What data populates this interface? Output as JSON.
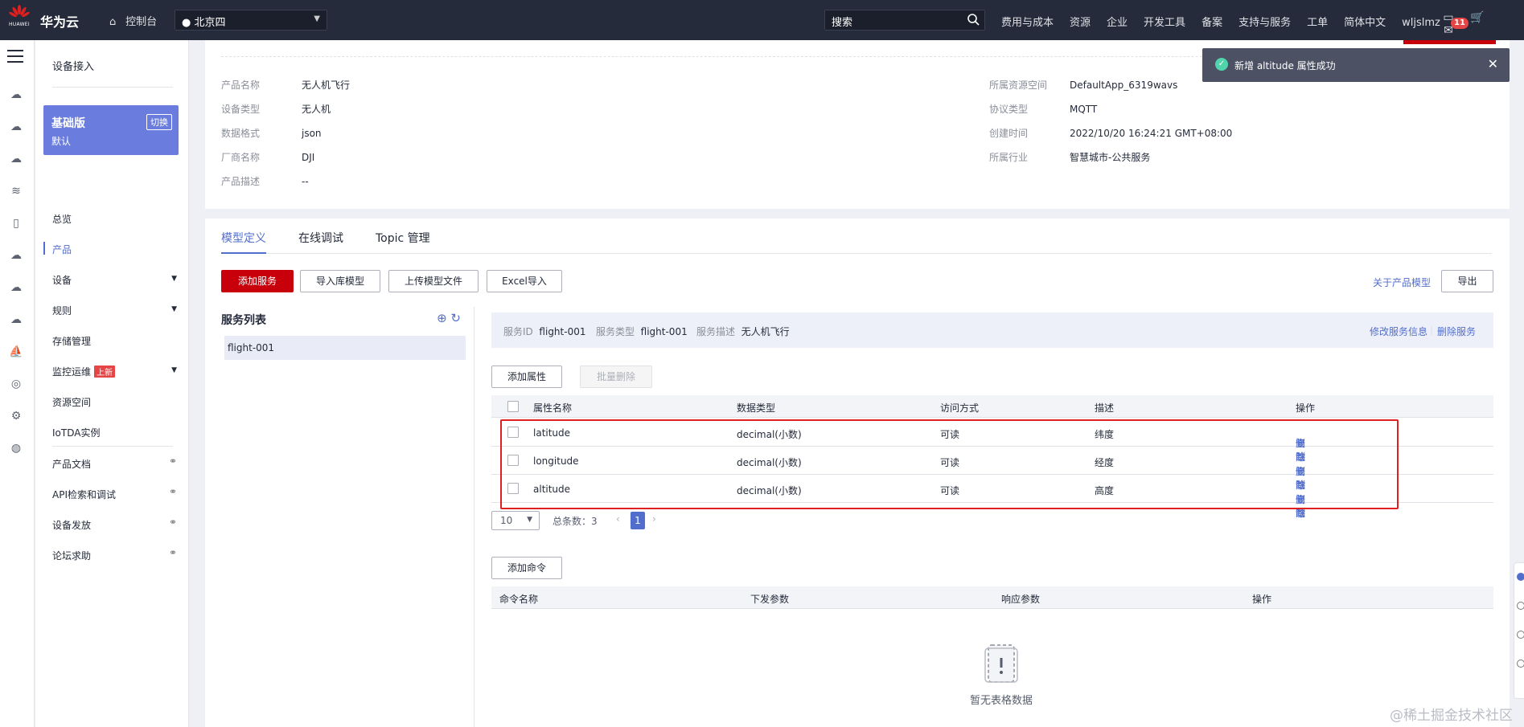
{
  "topbar": {
    "brand": "华为云",
    "brand_sub": "HUAWEI",
    "console": "控制台",
    "region": "北京四",
    "search_placeholder": "搜索",
    "nav": [
      "费用与成本",
      "资源",
      "企业",
      "开发工具",
      "备案",
      "支持与服务",
      "工单",
      "简体中文",
      "wljslmz"
    ],
    "notify_count": "11"
  },
  "sidebar": {
    "title": "设备接入",
    "edition_name": "基础版",
    "edition_sub": "默认",
    "edition_switch": "切换",
    "items": [
      "总览",
      "产品",
      "设备",
      "规则",
      "存储管理",
      "监控运维",
      "资源空间",
      "IoTDA实例",
      "产品文档",
      "API检索和调试",
      "设备发放",
      "论坛求助"
    ],
    "new_tag": "上新"
  },
  "product_info": {
    "left": [
      {
        "k": "产品名称",
        "v": "无人机飞行"
      },
      {
        "k": "设备类型",
        "v": "无人机"
      },
      {
        "k": "数据格式",
        "v": "json"
      },
      {
        "k": "厂商名称",
        "v": "DJI"
      },
      {
        "k": "产品描述",
        "v": "--"
      }
    ],
    "right": [
      {
        "k": "所属资源空间",
        "v": "DefaultApp_6319wavs"
      },
      {
        "k": "协议类型",
        "v": "MQTT"
      },
      {
        "k": "创建时间",
        "v": "2022/10/20 16:24:21 GMT+08:00"
      },
      {
        "k": "所属行业",
        "v": "智慧城市-公共服务"
      }
    ]
  },
  "tabs": [
    "模型定义",
    "在线调试",
    "Topic 管理"
  ],
  "toolbar": {
    "add_service": "添加服务",
    "import_lib": "导入库模型",
    "upload_model": "上传模型文件",
    "excel_import": "Excel导入",
    "about_model": "关于产品模型",
    "export": "导出"
  },
  "service_list": {
    "title": "服务列表",
    "items": [
      "flight-001"
    ]
  },
  "service_bar": {
    "id_label": "服务ID",
    "id_value": "flight-001",
    "type_label": "服务类型",
    "type_value": "flight-001",
    "desc_label": "服务描述",
    "desc_value": "无人机飞行",
    "edit": "修改服务信息",
    "delete": "删除服务"
  },
  "properties": {
    "add": "添加属性",
    "batch_delete": "批量删除",
    "columns": [
      "属性名称",
      "数据类型",
      "访问方式",
      "描述",
      "操作"
    ],
    "rows": [
      {
        "name": "latitude",
        "type": "decimal(小数)",
        "access": "可读",
        "desc": "纬度"
      },
      {
        "name": "longitude",
        "type": "decimal(小数)",
        "access": "可读",
        "desc": "经度"
      },
      {
        "name": "altitude",
        "type": "decimal(小数)",
        "access": "可读",
        "desc": "高度"
      }
    ],
    "ops": [
      "复制",
      "修改",
      "删除"
    ]
  },
  "pager": {
    "page_size": "10",
    "total_label": "总条数：3",
    "current": "1"
  },
  "commands": {
    "add": "添加命令",
    "columns": [
      "命令名称",
      "下发参数",
      "响应参数",
      "操作"
    ],
    "empty": "暂无表格数据"
  },
  "toast": {
    "message": "新增 altitude 属性成功"
  },
  "watermark": "@稀土掘金技术社区",
  "colors": {
    "topbar": "#252b3a",
    "primary_red": "#c7000b",
    "link_blue": "#526ecc",
    "edition_bg": "#6a7dde",
    "success": "#50d4ab"
  }
}
